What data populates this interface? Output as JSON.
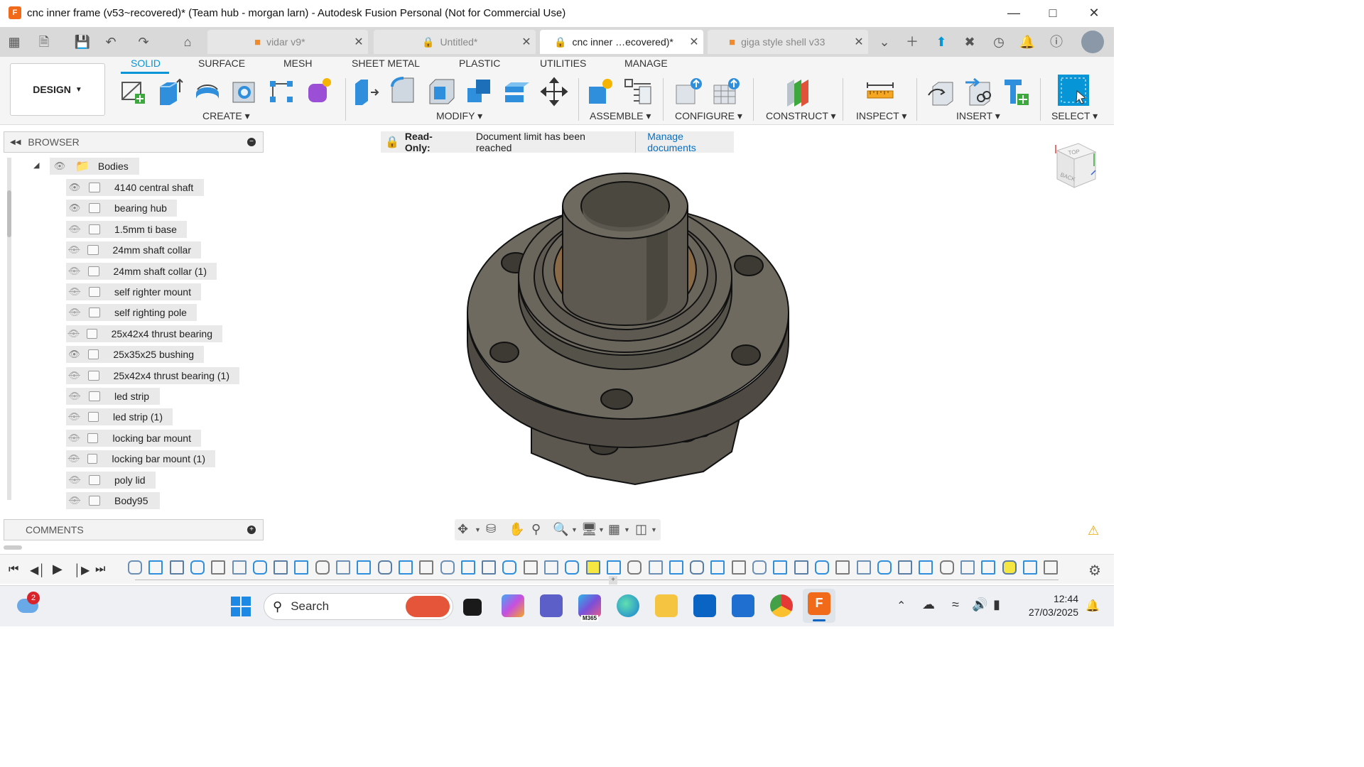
{
  "window": {
    "title": "cnc inner frame (v53~recovered)* (Team hub - morgan larn) - Autodesk Fusion Personal (Not for Commercial Use)",
    "app_icon_letter": "F"
  },
  "tabs": [
    {
      "label": "vidar v9*",
      "icon": "box-icon",
      "active": false
    },
    {
      "label": "Untitled*",
      "icon": "lock-icon",
      "active": false
    },
    {
      "label": "cnc inner …ecovered)*",
      "icon": "lock-icon",
      "active": true
    },
    {
      "label": "giga style shell v33",
      "icon": "box-icon",
      "active": false
    }
  ],
  "ribbon": {
    "workspace": "DESIGN",
    "tabs": [
      "SOLID",
      "SURFACE",
      "MESH",
      "SHEET METAL",
      "PLASTIC",
      "UTILITIES",
      "MANAGE"
    ],
    "active_tab": "SOLID",
    "groups": [
      "CREATE",
      "MODIFY",
      "ASSEMBLE",
      "CONFIGURE",
      "CONSTRUCT",
      "INSPECT",
      "INSERT",
      "SELECT"
    ]
  },
  "browser": {
    "title": "BROWSER",
    "folder": "Bodies",
    "bodies": [
      {
        "name": "4140 central shaft",
        "visible": true
      },
      {
        "name": "bearing hub",
        "visible": true
      },
      {
        "name": "1.5mm ti base",
        "visible": false
      },
      {
        "name": "24mm shaft collar",
        "visible": false
      },
      {
        "name": "24mm shaft collar (1)",
        "visible": false
      },
      {
        "name": "self righter mount",
        "visible": false
      },
      {
        "name": "self righting pole",
        "visible": false
      },
      {
        "name": "25x42x4 thrust bearing",
        "visible": false
      },
      {
        "name": "25x35x25 bushing",
        "visible": true
      },
      {
        "name": "25x42x4 thrust bearing (1)",
        "visible": false
      },
      {
        "name": "led strip",
        "visible": false
      },
      {
        "name": "led strip (1)",
        "visible": false
      },
      {
        "name": "locking bar mount",
        "visible": false
      },
      {
        "name": "locking bar mount (1)",
        "visible": false
      },
      {
        "name": "poly lid",
        "visible": false
      },
      {
        "name": "Body95",
        "visible": false
      }
    ]
  },
  "comments": {
    "title": "COMMENTS"
  },
  "banner": {
    "label": "Read-Only:",
    "message": "Document limit has been reached",
    "link": "Manage documents"
  },
  "viewcube": {
    "top": "TOP",
    "back": "BACK"
  },
  "taskbar": {
    "search_placeholder": "Search",
    "notification_count": "2",
    "time": "12:44",
    "date": "27/03/2025",
    "m365_label": "M365"
  },
  "colors": {
    "accent": "#0696d7",
    "part": "#6b675d",
    "bushing": "#8a6a46",
    "fusion_orange": "#f06a1a",
    "lock_red": "#d8232a"
  }
}
